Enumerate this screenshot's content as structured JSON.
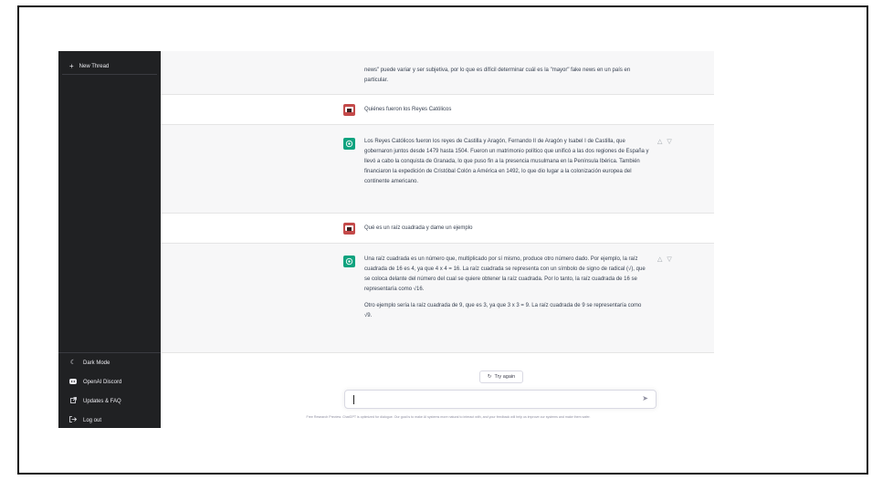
{
  "sidebar": {
    "new_thread": "New Thread",
    "items": [
      {
        "label": "Dark Mode",
        "icon": "moon-icon"
      },
      {
        "label": "OpenAI Discord",
        "icon": "discord-icon"
      },
      {
        "label": "Updates & FAQ",
        "icon": "external-link-icon"
      },
      {
        "label": "Log out",
        "icon": "logout-icon"
      }
    ]
  },
  "conversation": {
    "partial_bot": "news\" puede variar y ser subjetiva, por lo que es difícil determinar cuál es la \"mayor\" fake news en un país en particular.",
    "user1": "Quiénes fueron los Reyes Católicos",
    "bot1": "Los Reyes Católicos fueron los reyes de Castilla y Aragón, Fernando II de Aragón y Isabel I de Castilla, que gobernaron juntos desde 1479 hasta 1504. Fueron un matrimonio político que unificó a las dos regiones de España y llevó a cabo la conquista de Granada, lo que puso fin a la presencia musulmana en la Península Ibérica. También financiaron la expedición de Cristóbal Colón a América en 1492, lo que dio lugar a la colonización europea del continente americano.",
    "user2": "Qué es un raíz cuadrada y dame un ejemplo",
    "bot2_p1": "Una raíz cuadrada es un número que, multiplicado por sí mismo, produce otro número dado. Por ejemplo, la raíz cuadrada de 16 es 4, ya que 4 x 4 = 16. La raíz cuadrada se representa con un símbolo de signo de radical (√), que se coloca delante del número del cual se quiere obtener la raíz cuadrada. Por lo tanto, la raíz cuadrada de 16 se representaría como √16.",
    "bot2_p2": "Otro ejemplo sería la raíz cuadrada de 9, que es 3, ya que 3 x 3 = 9. La raíz cuadrada de 9 se representaría como √9."
  },
  "controls": {
    "try_again": "Try again",
    "input_value": "",
    "footer": "Free Research Preview: ChatGPT is optimized for dialogue. Our goal is to make AI systems more natural to interact with, and your feedback will help us improve our systems and make them safer."
  },
  "colors": {
    "sidebar_bg": "#202123",
    "bot_row_bg": "#f7f7f8",
    "accent": "#10a37f"
  }
}
